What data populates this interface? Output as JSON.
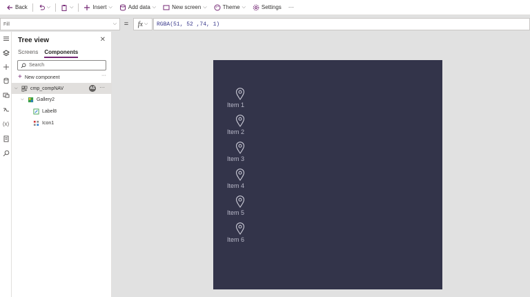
{
  "toolbar": {
    "back": "Back",
    "insert": "Insert",
    "add_data": "Add data",
    "new_screen": "New screen",
    "theme": "Theme",
    "settings": "Settings",
    "more": "···"
  },
  "formula": {
    "property": "Fill",
    "equals": "=",
    "fx": "fx",
    "expression": "RGBA(51, 52 ,74, 1)"
  },
  "tree": {
    "title": "Tree view",
    "tabs": [
      "Screens",
      "Components"
    ],
    "active_tab": "Components",
    "search_placeholder": "Search",
    "new_component": "New component",
    "nodes": [
      {
        "name": "cmp_compNAV",
        "badge": "AS"
      },
      {
        "name": "Gallery2"
      },
      {
        "name": "Label8"
      },
      {
        "name": "Icon1"
      }
    ]
  },
  "canvas": {
    "background": "#33344a",
    "items": [
      "Item 1",
      "Item 2",
      "Item 3",
      "Item 4",
      "Item 5",
      "Item 6"
    ]
  }
}
